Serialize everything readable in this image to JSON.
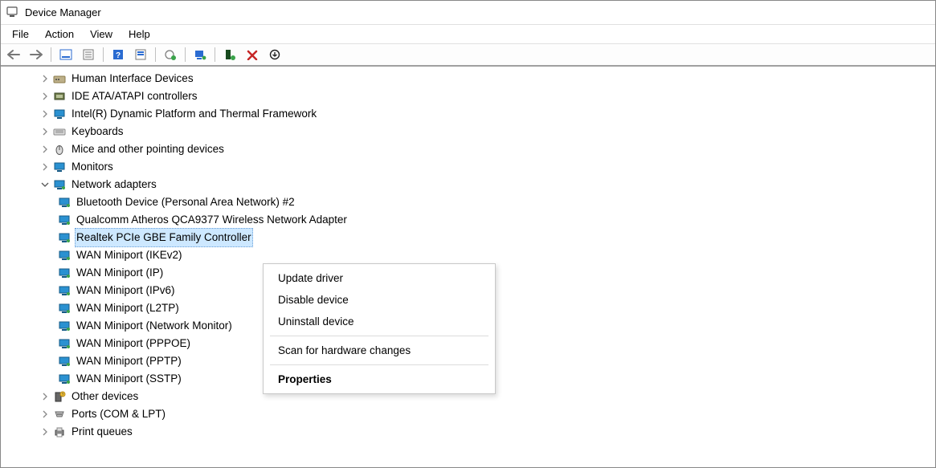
{
  "window": {
    "title": "Device Manager"
  },
  "menu": {
    "file": "File",
    "action": "Action",
    "view": "View",
    "help": "Help"
  },
  "tree": {
    "hid": {
      "label": "Human Interface Devices"
    },
    "ide": {
      "label": "IDE ATA/ATAPI controllers"
    },
    "intel": {
      "label": "Intel(R) Dynamic Platform and Thermal Framework"
    },
    "keyboards": {
      "label": "Keyboards"
    },
    "mice": {
      "label": "Mice and other pointing devices"
    },
    "monitors": {
      "label": "Monitors"
    },
    "network": {
      "label": "Network adapters"
    },
    "network_children": {
      "bt": {
        "label": "Bluetooth Device (Personal Area Network) #2"
      },
      "qcom": {
        "label": "Qualcomm Atheros QCA9377 Wireless Network Adapter"
      },
      "realtek": {
        "label": "Realtek PCIe GBE Family Controller"
      },
      "wan_ikev2": {
        "label": "WAN Miniport (IKEv2)"
      },
      "wan_ip": {
        "label": "WAN Miniport (IP)"
      },
      "wan_ipv6": {
        "label": "WAN Miniport (IPv6)"
      },
      "wan_l2tp": {
        "label": "WAN Miniport (L2TP)"
      },
      "wan_netmon": {
        "label": "WAN Miniport (Network Monitor)"
      },
      "wan_pppoe": {
        "label": "WAN Miniport (PPPOE)"
      },
      "wan_pptp": {
        "label": "WAN Miniport (PPTP)"
      },
      "wan_sstp": {
        "label": "WAN Miniport (SSTP)"
      }
    },
    "other": {
      "label": "Other devices"
    },
    "ports": {
      "label": "Ports (COM & LPT)"
    },
    "printq": {
      "label": "Print queues"
    }
  },
  "context_menu": {
    "update": "Update driver",
    "disable": "Disable device",
    "uninstall": "Uninstall device",
    "scan": "Scan for hardware changes",
    "props": "Properties"
  }
}
